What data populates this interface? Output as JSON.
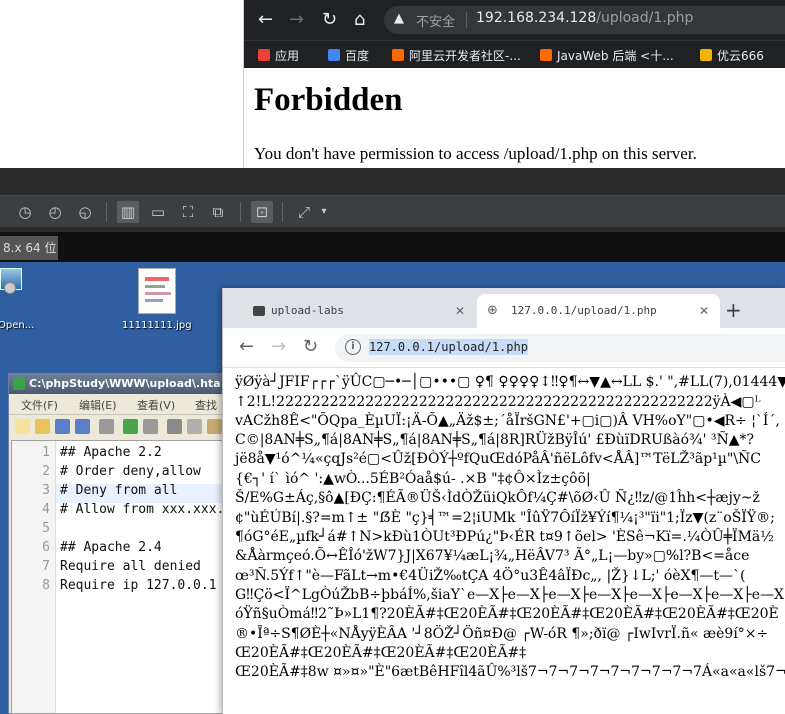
{
  "top_browser": {
    "insecure_label": "不安全",
    "url_host": "192.168.234.128",
    "url_path": "/upload/1.php",
    "bookmarks": [
      {
        "label": "应用",
        "color": "#ea4335"
      },
      {
        "label": "百度",
        "color": "#4285f4"
      },
      {
        "label": "阿里云开发者社区-...",
        "color": "#ff6a00"
      },
      {
        "label": "JavaWeb 后端 <十...",
        "color": "#ff6a00"
      },
      {
        "label": "优云666",
        "color": "#f4b400"
      }
    ],
    "page_title": "Forbidden",
    "page_message": "You don't have permission to access /upload/1.php on this server."
  },
  "vm": {
    "tab_label": "8.x 64 位"
  },
  "desktop": {
    "icons": [
      {
        "label": "Open..."
      },
      {
        "label": "11111111.jpg"
      }
    ]
  },
  "notepad": {
    "title": "C:\\phpStudy\\WWW\\upload\\.hta",
    "menu": [
      "文件(F)",
      "编辑(E)",
      "查看(V)",
      "查找"
    ],
    "lines": [
      "## Apache 2.2",
      "# Order deny,allow",
      "# Deny from all",
      "# Allow from xxx.xxx.",
      "",
      "## Apache 2.4",
      "Require all denied",
      "Require ip 127.0.0.1"
    ],
    "line_numbers": [
      "1",
      "2",
      "3",
      "4",
      "5",
      "6",
      "7",
      "8"
    ]
  },
  "fg_browser": {
    "tab1_label": "upload-labs",
    "tab2_label": "127.0.0.1/upload/1.php",
    "url": "127.0.0.1/upload/1.php",
    "garbled_lines": [
      "ÿØÿà┘JFIF┌┌┌`ÿÛC▢─•─│▢•••▢ ♀¶ ♀♀♀♀↕‼♀¶↔▼▲↔LL $.' \",#LL(7),01444▼'9",
      "↑2!L!2222222222222222222222222222222222222222222222222ÿÀ◀▢ᴸ",
      "vACžh8Ê<\"ÕQpa_ÈµUÏ:¡Ä-Õ▲„Äž$±;´åÏršGN£'+▢i▢)Â VH%oY\"▢•◀R÷ ¦`Í´,",
      "C©|8AN╪S„¶á|8AN╪S„¶á|8AN╪S„¶á|8R]RÜžBÿÎú' £ÐùïDRUßàó¾' ³Ñ▲*?",
      "jë8å▼¹ó^¼«çqJs²é▢<Ûž[ÐÒÝ┼ºfQuŒdóPåÂ'ñëLôfv<ÅÂ]™TëLŽ³ãp¹µ\"\\ÑC",
      "{€┐' í` ìó^ ':▲wÒ...5ÉB²Óaå$ú- .×B \"‡¢Ô×Ìz±çôõ|",
      "Š/E%G±Áç,§ô▲[ÐÇ:¶ÉÃ®ÜŠ‹ÌdÒŽüiQkÔf¼Ç#\\õØ‹Û Ñ¿‼z/@1ĥh<┼æjy~ž",
      "¢\"ùÉÚBí|.§?=m↑± \"ẞÈ \"ç}╡™=2¦iUMk \"ÎûŸ7ÔíÏž¥Ýí¶¼¡³\"ïi\"1;Ïz▼(z¨oŠÏŸ®;",
      "¶óG°éE„µfk┘á#↑N>kÐù1ÒUt³ÐPú¿\"Þ‹ÉR t¤9↑õel> 'ÈSê¬Kï=.¼ÒÛ╪ÏMä½",
      "&Åàrmçeó.Õ↔ÊÎó'žW7}J|X67¥¼æL¡¾„HëÂV7³ Ã°„L¡—by»▢%l?B<=åce",
      "œ³Ñ.5Ýf↑\"è—FãLt→m•€4ÜiŽ‰tÇA 4Ö°u3Ê4âÏÐc„, |Ž}↓L;' óèX¶—t—`(",
      "G‼Çö<Ï^LgÒúŽbB÷þbáÍ%,šiaY`e—X├e—X├e—X├e—X├e—X├e—X├e—X├e—X├e—X ×",
      "óŸñ§uÒmá‼2˜Þ»L1¶?20ÈÃ#‡Œ20ÈÃ#‡Œ20ÈÃ#‡Œ20ÈÃ#‡Œ20ÈÃ#‡Œ20È",
      "®•Ĩª÷S¶ØÈ┼«NÅyÿÈÂA '┘8ÖŽ┘Öñ¤Ð@ ┌W-óR ¶»;ðï@ ┌IwIvrÏ.ñ« æè9í°×÷",
      "Œ20ÈÃ#‡Œ20ÈÃ#‡Œ20ÈÃ#‡Œ20ÈÃ#‡",
      "Œ20ÈÃ#‡8w ¤»¤»\"È\"6ætBêHFîl4ãÛ%³lš7¬7¬7¬7¬7¬7¬7¬7¬7Á«a«a«lš7¬7¬7"
    ]
  }
}
